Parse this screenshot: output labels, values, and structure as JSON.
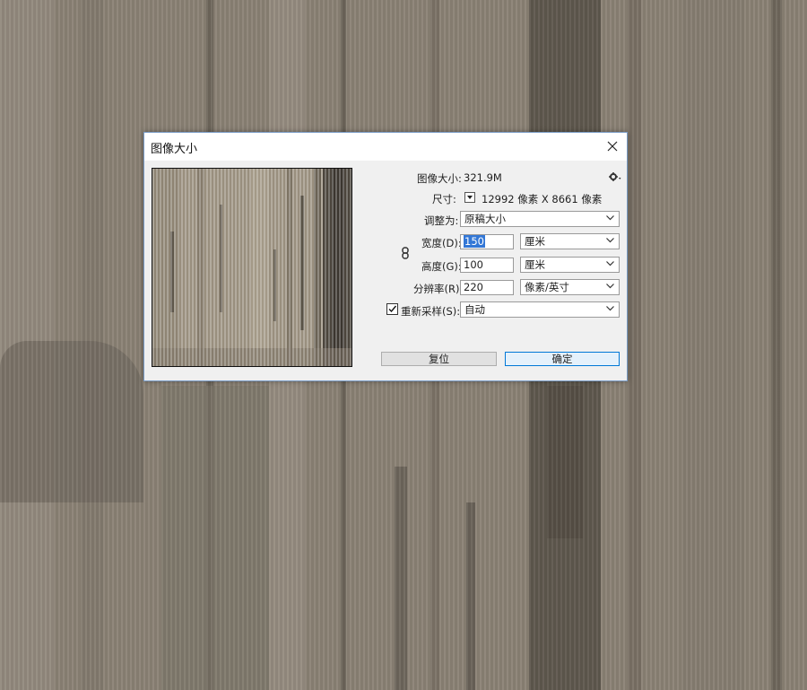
{
  "dialog": {
    "title": "图像大小",
    "image_size_label": "图像大小:",
    "image_size_value": "321.9M",
    "dimensions_label": "尺寸:",
    "dimensions_value": "12992 像素  X  8661 像素",
    "fit_to_label": "调整为:",
    "fit_to_value": "原稿大小",
    "width_label": "宽度(D):",
    "width_value": "150",
    "width_unit": "厘米",
    "height_label": "高度(G):",
    "height_value": "100",
    "height_unit": "厘米",
    "resolution_label": "分辨率(R):",
    "resolution_value": "220",
    "resolution_unit": "像素/英寸",
    "resample_label": "重新采样(S):",
    "resample_checked": true,
    "resample_value": "自动",
    "reset_label": "复位",
    "ok_label": "确定"
  },
  "icons": {
    "close": "close-icon",
    "gear": "gear-icon",
    "chain": "link-chain-icon",
    "dropdown": "chevron-down-icon"
  },
  "colors": {
    "dialog_bg": "#f0f0f0",
    "accent": "#0078d7",
    "selection": "#3377d6",
    "texture_base": "#8b8275"
  }
}
